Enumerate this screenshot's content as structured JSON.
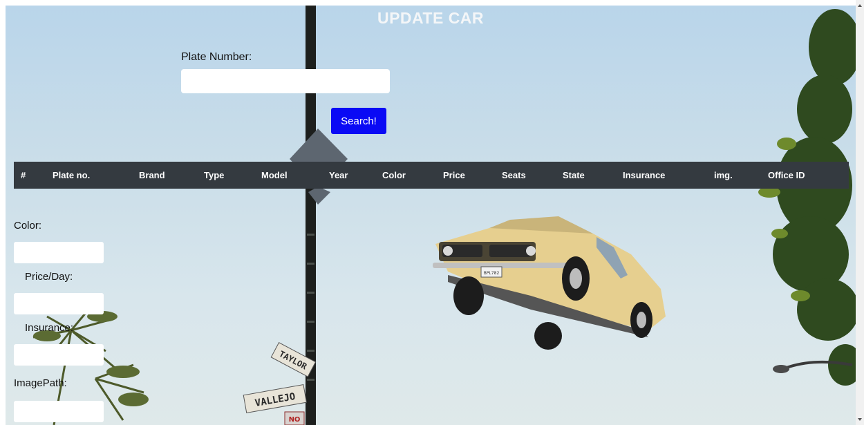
{
  "page": {
    "title": "UPDATE CAR"
  },
  "search": {
    "plate_label": "Plate Number:",
    "plate_value": "",
    "button_label": "Search!"
  },
  "table": {
    "headers": [
      "#",
      "Plate no.",
      "Brand",
      "Type",
      "Model",
      "Year",
      "Color",
      "Price",
      "Seats",
      "State",
      "Insurance",
      "img.",
      "Office ID"
    ],
    "rows": []
  },
  "form": {
    "color_label": "Color:",
    "color_value": "",
    "price_label": "Price/Day:",
    "price_value": "",
    "insurance_label": "Insurance:",
    "insurance_value": "",
    "image_path_label": "ImagePath:",
    "image_path_value": ""
  },
  "colors": {
    "search_button": "#0a0af5",
    "table_header_bg": "#343a40",
    "title_text": "#f4f6f8"
  },
  "background": {
    "street_signs": [
      "TAYLOR",
      "VALLEJO",
      "NO"
    ],
    "car_plate_text": "BPL782"
  }
}
